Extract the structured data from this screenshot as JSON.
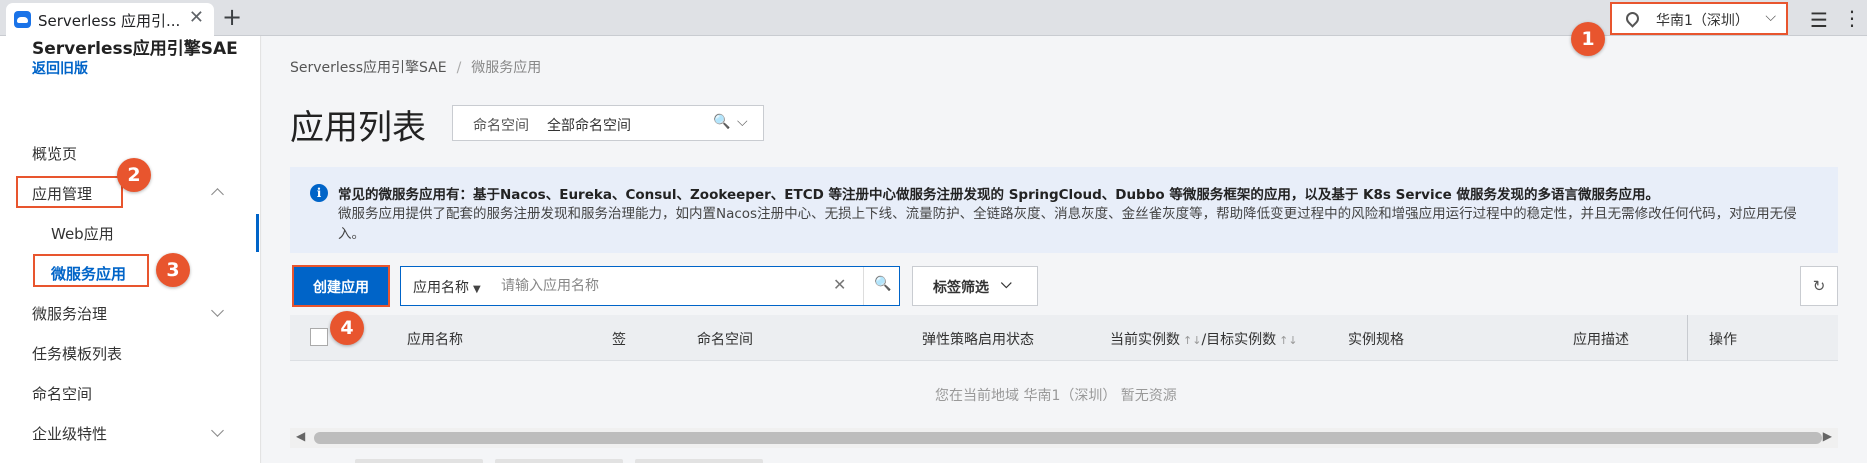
{
  "browser": {
    "tab_title": "Serverless 应用引...",
    "tab_close": "✕",
    "new_tab": "+",
    "region_label": "华南1（深圳）",
    "region_chevron": "⌵",
    "menu_icon": "☰",
    "more_icon": "⋮"
  },
  "badges": [
    "1",
    "2",
    "3",
    "4"
  ],
  "sidebar": {
    "product_title": "Serverless应用引擎SAE",
    "return_link": "返回旧版",
    "items": {
      "overview": "概览页",
      "app_management": "应用管理",
      "web_app": "Web应用",
      "microservice_app": "微服务应用",
      "microservice_governance": "微服务治理",
      "task_templates": "任务模板列表",
      "namespace": "命名空间",
      "enterprise_features": "企业级特性"
    },
    "collapse_icon": "❮"
  },
  "breadcrumb": {
    "root": "Serverless应用引擎SAE",
    "separator": "/",
    "current": "微服务应用"
  },
  "page": {
    "title": "应用列表",
    "namespace_label": "命名空间",
    "namespace_value": "全部命名空间",
    "namespace_search_icon": "🔍",
    "namespace_chevron": "⌵"
  },
  "notice": {
    "icon": "i",
    "line1": "常见的微服务应用有：基于Nacos、Eureka、Consul、Zookeeper、ETCD 等注册中心做服务注册发现的 SpringCloud、Dubbo 等微服务框架的应用，以及基于 K8s Service 做服务发现的多语言微服务应用。",
    "line2": "微服务应用提供了配套的服务注册发现和服务治理能力，如内置Nacos注册中心、无损上下线、流量防护、全链路灰度、消息灰度、金丝雀灰度等，帮助降低变更过程中的风险和增强应用运行过程中的稳定性，并且无需修改任何代码，对应用无侵入。"
  },
  "toolbar": {
    "create_button": "创建应用",
    "search_field": "应用名称",
    "search_caret": "▼",
    "search_placeholder": "请输入应用名称",
    "search_clear": "✕",
    "search_icon": "🔍",
    "tag_filter": "标签筛选",
    "tag_filter_chevron": "⌵",
    "refresh_icon": "↻"
  },
  "table": {
    "columns": {
      "app_name": "应用名称",
      "tag": "签",
      "namespace": "命名空间",
      "elastic_status": "弹性策略启用状态",
      "instances": "当前实例数",
      "sort1": "↑↓",
      "target_instances": "/目标实例数",
      "sort2": "↑↓",
      "spec": "实例规格",
      "description": "应用描述",
      "actions": "操作"
    },
    "empty_text": "您在当前地域 华南1（深圳） 暂无资源"
  },
  "scroll": {
    "left": "◀",
    "right": "▶"
  }
}
